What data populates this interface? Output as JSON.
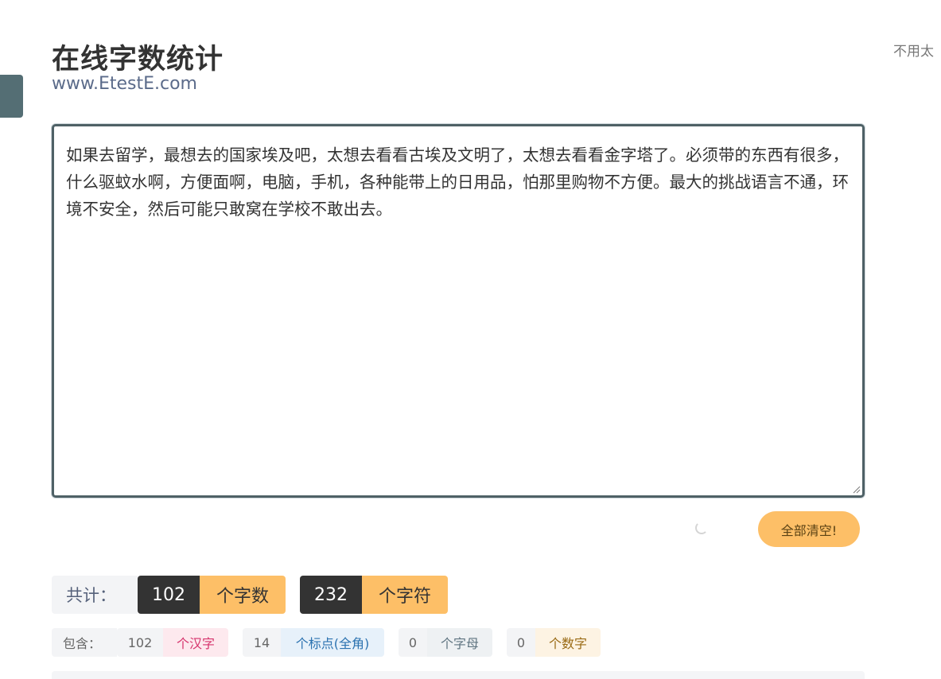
{
  "header": {
    "title": "在线字数统计",
    "subtitle": "www.EtestE.com",
    "top_right_text": "不用太"
  },
  "editor": {
    "content": "如果去留学，最想去的国家埃及吧，太想去看看古埃及文明了，太想去看看金字塔了。必须带的东西有很多，什么驱蚊水啊，方便面啊，电脑，手机，各种能带上的日用品，怕那里购物不方便。最大的挑战语言不通，环境不安全，然后可能只敢窝在学校不敢出去。"
  },
  "actions": {
    "clear_label": "全部清空!"
  },
  "totals": {
    "label": "共计：",
    "char_count": "102",
    "char_unit": "个字数",
    "symbol_count": "232",
    "symbol_unit": "个字符"
  },
  "details": {
    "label": "包含：",
    "items": [
      {
        "count": "102",
        "unit": "个汉字"
      },
      {
        "count": "14",
        "unit": "个标点(全角)"
      },
      {
        "count": "0",
        "unit": "个字母"
      },
      {
        "count": "0",
        "unit": "个数字"
      }
    ]
  },
  "colors": {
    "accent": "#fdbf67",
    "dark": "#333333",
    "side_tab": "#546e74",
    "editor_border": "#4f6166",
    "hanzi_bg": "#fde9ee",
    "hanzi_fg": "#d6336c",
    "punct_bg": "#e7f1fa",
    "punct_fg": "#2b72b0",
    "letter_bg": "#eef1f3",
    "letter_fg": "#5f7480",
    "digit_bg": "#fdf3e3",
    "digit_fg": "#9a6a14"
  }
}
